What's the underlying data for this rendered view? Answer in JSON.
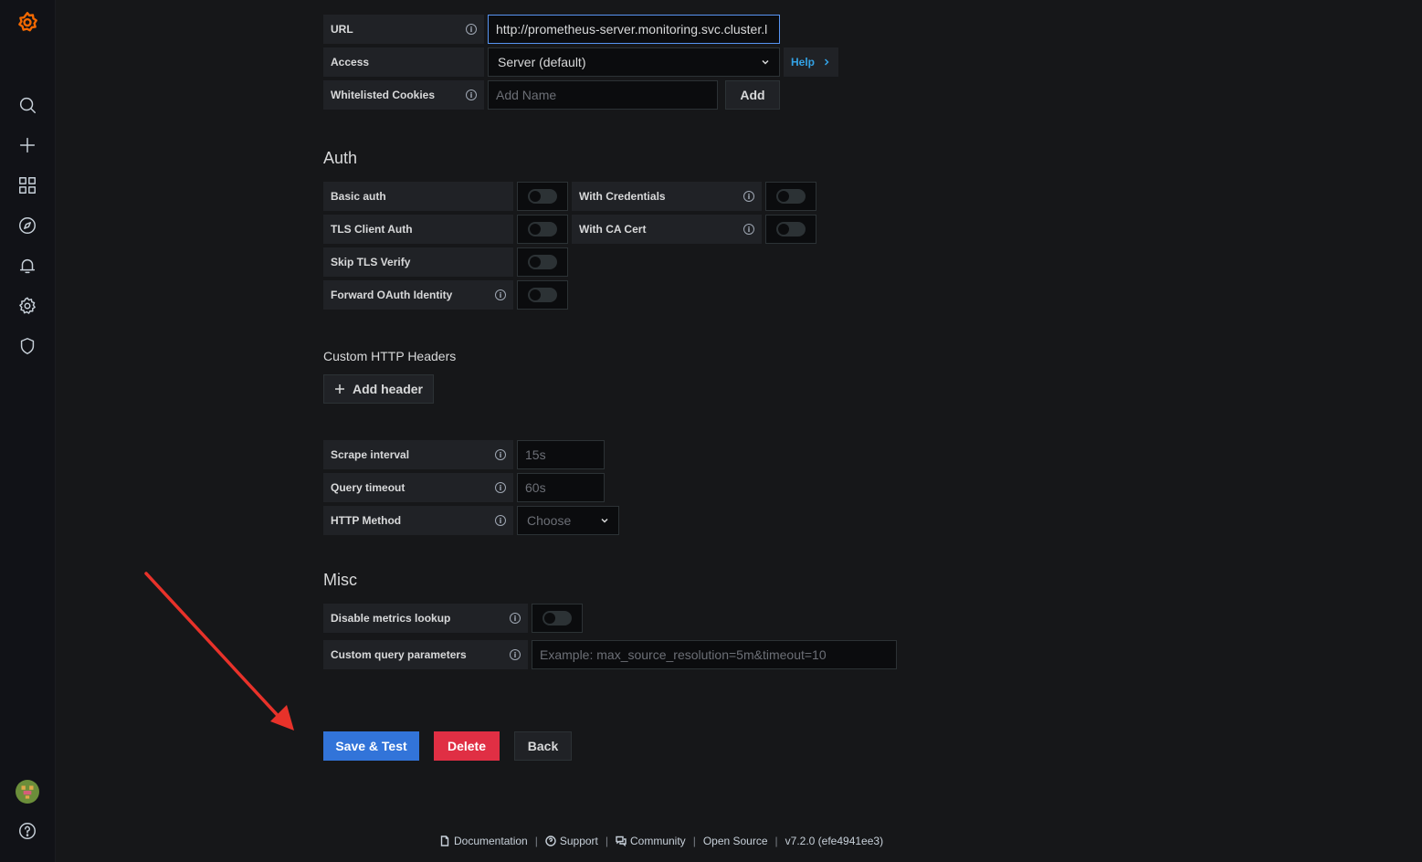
{
  "colors": {
    "accent": "#3274d9",
    "danger": "#e02f44",
    "link": "#33a2e5",
    "logo": "#f46800",
    "annotation_arrow": "#e8322a"
  },
  "sidebar": {
    "items": [
      {
        "icon": "search-icon"
      },
      {
        "icon": "plus-icon"
      },
      {
        "icon": "dashboards-icon"
      },
      {
        "icon": "explore-icon"
      },
      {
        "icon": "bell-icon"
      },
      {
        "icon": "gear-icon"
      },
      {
        "icon": "shield-icon"
      }
    ],
    "bottom": [
      {
        "icon": "avatar"
      },
      {
        "icon": "help-icon"
      }
    ]
  },
  "http": {
    "url_label": "URL",
    "url_value": "http://prometheus-server.monitoring.svc.cluster.l",
    "access_label": "Access",
    "access_value": "Server (default)",
    "help_label": "Help",
    "cookies_label": "Whitelisted Cookies",
    "cookies_placeholder": "Add Name",
    "add_label": "Add"
  },
  "auth": {
    "title": "Auth",
    "basic_auth": "Basic auth",
    "with_credentials": "With Credentials",
    "tls_client_auth": "TLS Client Auth",
    "with_ca_cert": "With CA Cert",
    "skip_tls_verify": "Skip TLS Verify",
    "forward_oauth": "Forward OAuth Identity"
  },
  "headers": {
    "title": "Custom HTTP Headers",
    "add_header": "Add header"
  },
  "prometheus": {
    "scrape_label": "Scrape interval",
    "scrape_placeholder": "15s",
    "timeout_label": "Query timeout",
    "timeout_placeholder": "60s",
    "method_label": "HTTP Method",
    "method_placeholder": "Choose"
  },
  "misc": {
    "title": "Misc",
    "disable_metrics": "Disable metrics lookup",
    "custom_query_label": "Custom query parameters",
    "custom_query_placeholder": "Example: max_source_resolution=5m&timeout=10"
  },
  "actions": {
    "save": "Save & Test",
    "delete": "Delete",
    "back": "Back"
  },
  "footer": {
    "documentation": "Documentation",
    "support": "Support",
    "community": "Community",
    "open_source": "Open Source",
    "version": "v7.2.0 (efe4941ee3)",
    "separator": "|"
  }
}
